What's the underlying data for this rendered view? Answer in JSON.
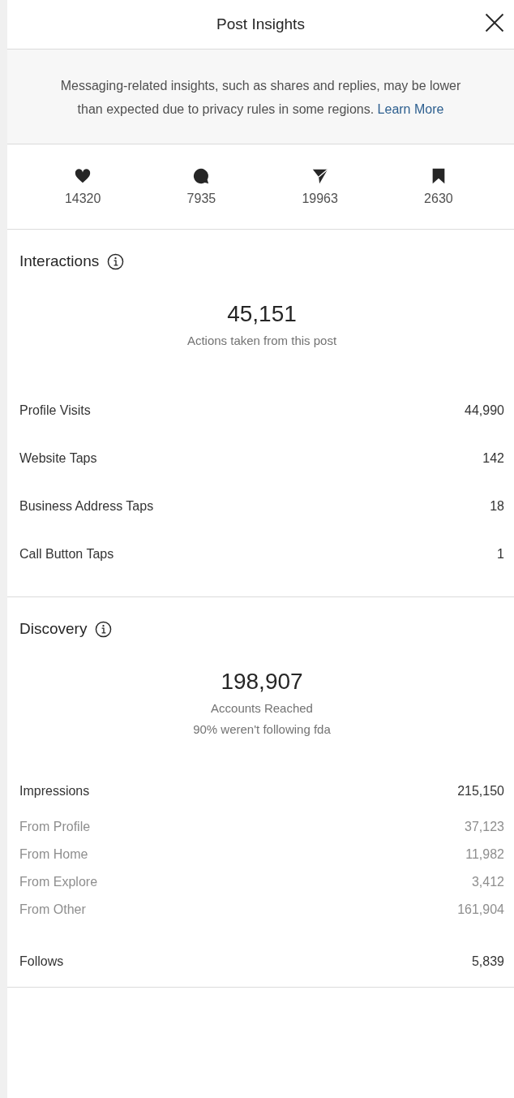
{
  "header": {
    "title": "Post Insights"
  },
  "notice": {
    "text": "Messaging-related insights, such as shares and replies, may be lower than expected due to privacy rules in some regions.",
    "link": "Learn More"
  },
  "stats": [
    {
      "kind": "likes",
      "value": "14320"
    },
    {
      "kind": "comments",
      "value": "7935"
    },
    {
      "kind": "shares",
      "value": "19963"
    },
    {
      "kind": "saves",
      "value": "2630"
    }
  ],
  "sections": [
    {
      "title": "Interactions",
      "total": "45,151",
      "captions": [
        "Actions taken from this post"
      ],
      "rows": [
        {
          "kind": "primary",
          "label": "Profile Visits",
          "value": "44,990"
        },
        {
          "kind": "primary",
          "label": "Website Taps",
          "value": "142"
        },
        {
          "kind": "primary",
          "label": "Business Address Taps",
          "value": "18"
        },
        {
          "kind": "primary",
          "label": "Call Button Taps",
          "value": "1"
        }
      ]
    },
    {
      "title": "Discovery",
      "total": "198,907",
      "captions": [
        "Accounts Reached",
        "90% weren't following fda"
      ],
      "rows": [
        {
          "kind": "compact",
          "label": "Impressions",
          "value": "215,150"
        },
        {
          "kind": "secondary",
          "label": "From Profile",
          "value": "37,123"
        },
        {
          "kind": "secondary",
          "label": "From Home",
          "value": "11,982"
        },
        {
          "kind": "secondary",
          "label": "From Explore",
          "value": "3,412"
        },
        {
          "kind": "secondary",
          "label": "From Other",
          "value": "161,904"
        },
        {
          "kind": "final",
          "label": "Follows",
          "value": "5,839"
        }
      ]
    }
  ]
}
